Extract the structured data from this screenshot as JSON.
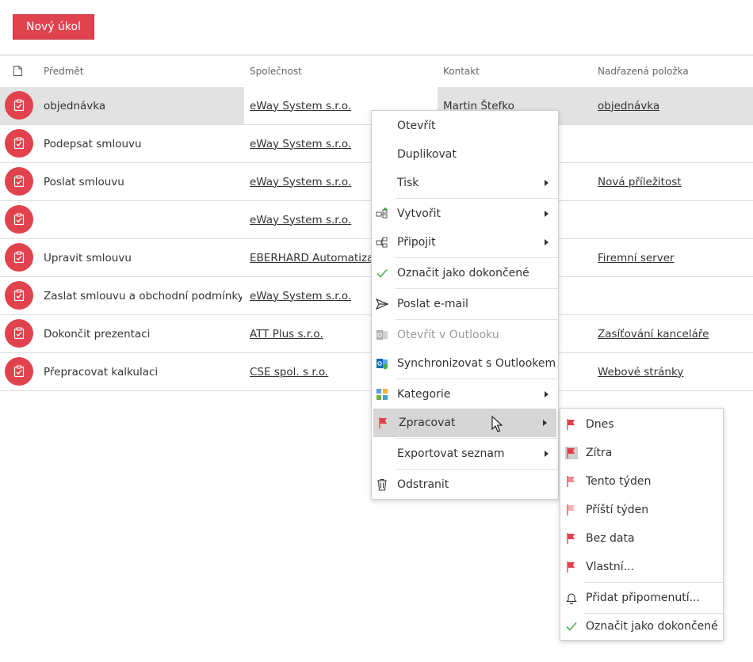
{
  "toolbar": {
    "new_task_label": "Nový úkol"
  },
  "grid": {
    "columns": [
      "Předmět",
      "Společnost",
      "Kontakt",
      "Nadřazená položka"
    ],
    "rows": [
      {
        "subject": "objednávka",
        "company": "eWay System s.r.o.",
        "contact": "Martin Štefko",
        "parent": "objednávka"
      },
      {
        "subject": "Podepsat smlouvu",
        "company": "eWay System s.r.o.",
        "contact": "",
        "parent": ""
      },
      {
        "subject": "Poslat smlouvu",
        "company": "eWay System s.r.o.",
        "contact": "",
        "parent": "Nová příležitost"
      },
      {
        "subject": "",
        "company": "eWay System s.r.o.",
        "contact": "",
        "parent": ""
      },
      {
        "subject": "Upravit smlouvu",
        "company": "EBERHARD Automatizace",
        "contact": "",
        "parent": "Firemní server"
      },
      {
        "subject": "Zaslat smlouvu a obchodní podmínky",
        "company": "eWay System s.r.o.",
        "contact": "",
        "parent": ""
      },
      {
        "subject": "Dokončit prezentaci",
        "company": "ATT Plus s.r.o.",
        "contact": "",
        "parent": "Zasíťování kanceláře"
      },
      {
        "subject": "Přepracovat kalkulaci",
        "company": "CSE spol. s r.o.",
        "contact": "",
        "parent": "Webové stránky"
      }
    ]
  },
  "context_menu": {
    "items": [
      {
        "label": "Otevřít"
      },
      {
        "label": "Duplikovat"
      },
      {
        "label": "Tisk"
      },
      {
        "label": "Vytvořit"
      },
      {
        "label": "Připojit"
      },
      {
        "label": "Označit jako dokončené"
      },
      {
        "label": "Poslat e-mail"
      },
      {
        "label": "Otevřít v Outlooku"
      },
      {
        "label": "Synchronizovat s Outlookem"
      },
      {
        "label": "Kategorie"
      },
      {
        "label": "Zpracovat"
      },
      {
        "label": "Exportovat seznam"
      },
      {
        "label": "Odstranit"
      }
    ]
  },
  "submenu": {
    "items": [
      {
        "label": "Dnes"
      },
      {
        "label": "Zítra"
      },
      {
        "label": "Tento týden"
      },
      {
        "label": "Příští týden"
      },
      {
        "label": "Bez data"
      },
      {
        "label": "Vlastní..."
      },
      {
        "label": "Přidat připomenutí..."
      },
      {
        "label": "Označit jako dokončené"
      }
    ]
  },
  "colors": {
    "accent": "#e0434e",
    "check": "#4caf50",
    "selected_row": "#e2e2e2"
  }
}
